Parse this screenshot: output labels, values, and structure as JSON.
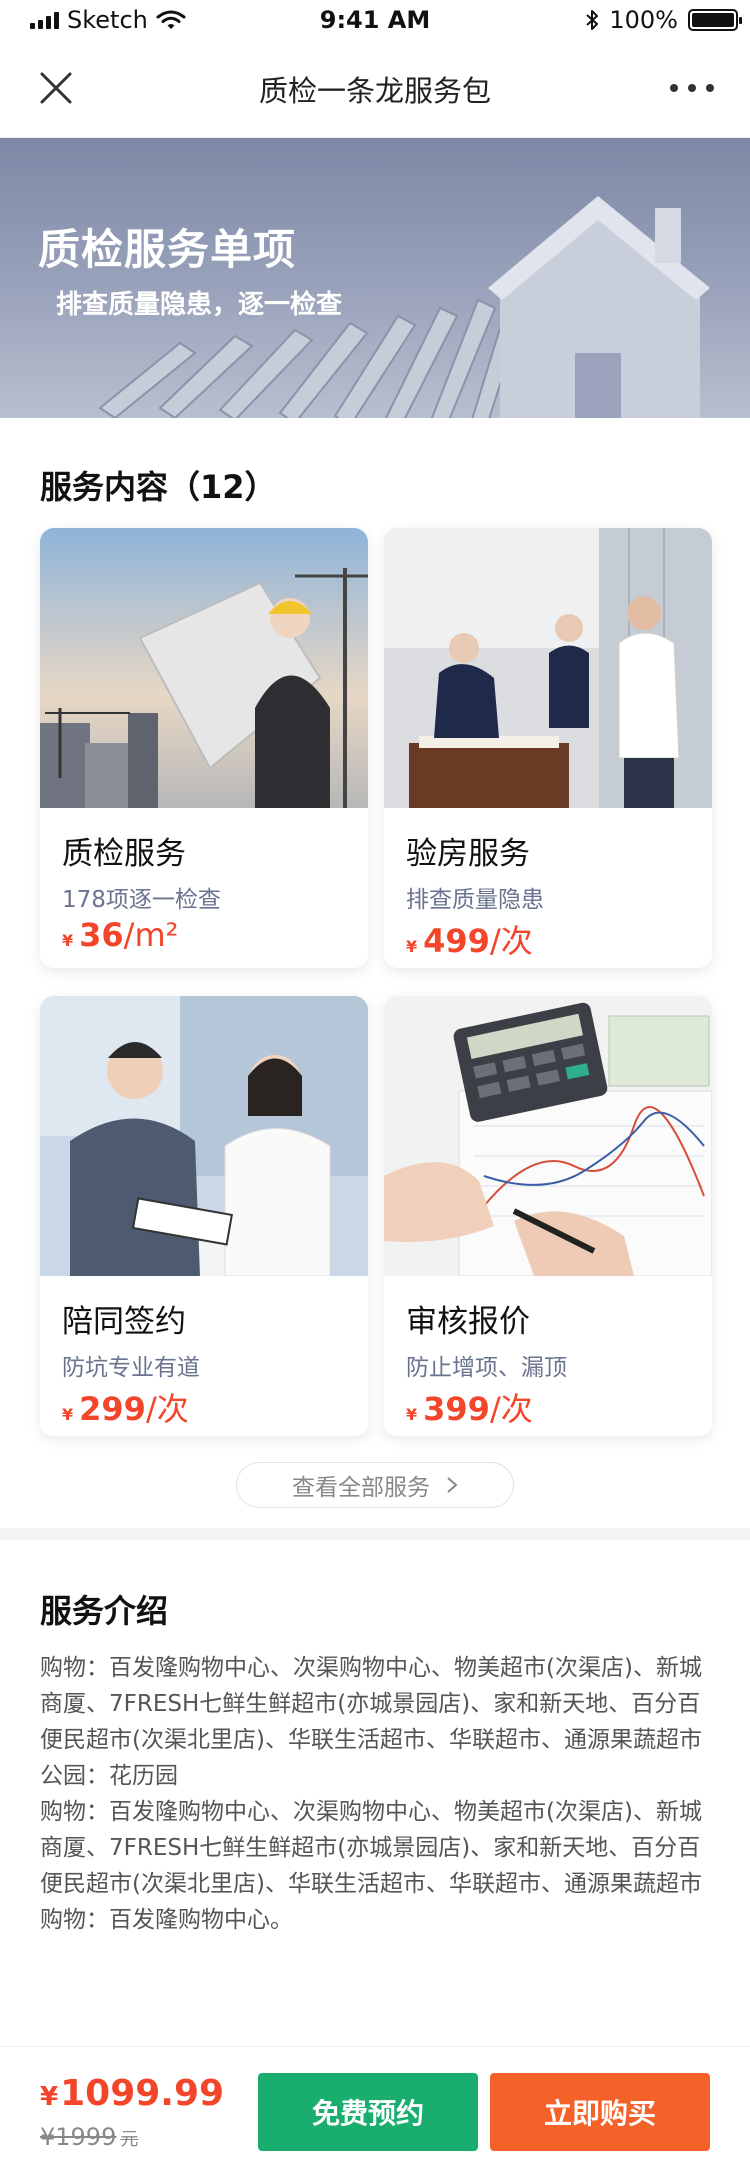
{
  "status_bar": {
    "carrier": "Sketch",
    "time": "9:41 AM",
    "battery": "100%",
    "icons": [
      "signal-icon",
      "wifi-icon",
      "bluetooth-icon",
      "battery-icon"
    ]
  },
  "nav": {
    "title": "质检一条龙服务包",
    "icons": [
      "close-icon",
      "more-icon"
    ]
  },
  "banner": {
    "title": "质检服务单项",
    "subtitle": "排查质量隐患，逐一检查"
  },
  "services": {
    "heading": "服务内容（12）",
    "items": [
      {
        "name": "质检服务",
        "desc": "178项逐一检查",
        "currency": "¥",
        "price": "36",
        "unit": "/m²"
      },
      {
        "name": "验房服务",
        "desc": "排查质量隐患",
        "currency": "¥",
        "price": "499",
        "unit": "/次"
      },
      {
        "name": "陪同签约",
        "desc": "防坑专业有道",
        "currency": "¥",
        "price": "299",
        "unit": "/次"
      },
      {
        "name": "审核报价",
        "desc": "防止增项、漏顶",
        "currency": "¥",
        "price": "399",
        "unit": "/次"
      }
    ],
    "view_all": "查看全部服务"
  },
  "intro": {
    "heading": "服务介绍",
    "paragraphs": [
      "购物：百发隆购物中心、次渠购物中心、物美超市(次渠店)、新城商厦、7FRESH七鲜生鲜超市(亦城景园店)、家和新天地、百分百便民超市(次渠北里店)、华联生活超市、华联超市、通源果蔬超市",
      "公园：花历园",
      "购物：百发隆购物中心、次渠购物中心、物美超市(次渠店)、新城商厦、7FRESH七鲜生鲜超市(亦城景园店)、家和新天地、百分百便民超市(次渠北里店)、华联生活超市、华联超市、通源果蔬超市",
      "购物：百发隆购物中心。"
    ]
  },
  "bottom": {
    "currency": "¥",
    "price": "1099.99",
    "original_price": "¥1999",
    "original_unit": "元",
    "free_button": "免费预约",
    "buy_button": "立即购买"
  },
  "colors": {
    "accent_red": "#f2452a",
    "green": "#1aae6e",
    "orange": "#f4622a",
    "banner": "#8a94b0"
  }
}
